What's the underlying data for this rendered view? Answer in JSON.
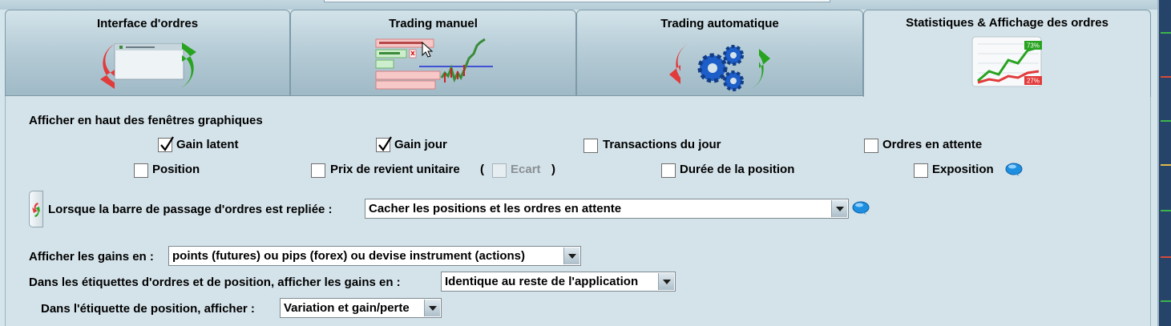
{
  "tabs": [
    {
      "label": "Interface d'ordres",
      "icon": "order-interface-icon"
    },
    {
      "label": "Trading manuel",
      "icon": "manual-trading-icon"
    },
    {
      "label": "Trading automatique",
      "icon": "automatic-trading-icon"
    },
    {
      "label": "Statistiques & Affichage des ordres",
      "icon": "statistics-chart-icon",
      "chart_badges": [
        "73%",
        "27%"
      ]
    }
  ],
  "section_title": "Afficher en haut des fenêtres graphiques",
  "checkboxes": {
    "gain_latent": {
      "label": "Gain latent",
      "checked": true
    },
    "gain_jour": {
      "label": "Gain jour",
      "checked": true
    },
    "transactions_du_jour": {
      "label": "Transactions du jour",
      "checked": false
    },
    "ordres_en_attente": {
      "label": "Ordres en attente",
      "checked": false
    },
    "position": {
      "label": "Position",
      "checked": false
    },
    "prix_de_revient": {
      "label": "Prix de revient unitaire",
      "checked": false
    },
    "ecart": {
      "label": "Ecart",
      "checked": false,
      "disabled": true
    },
    "duree_position": {
      "label": "Durée de la position",
      "checked": false
    },
    "exposition": {
      "label": "Exposition",
      "checked": false
    }
  },
  "paren_open": "(",
  "paren_close": ")",
  "collapsed_bar": {
    "label": "Lorsque la barre de passage d'ordres est repliée :",
    "value": "Cacher les positions et les ordres en attente"
  },
  "gains_unit": {
    "label": "Afficher les gains en :",
    "value": "points (futures) ou pips (forex) ou devise instrument (actions)"
  },
  "labels_gains": {
    "label": "Dans les étiquettes d'ordres et de position, afficher les gains en :",
    "value": "Identique au reste de l'application"
  },
  "position_label": {
    "label": "Dans l'étiquette de position, afficher :",
    "value": "Variation et gain/perte"
  },
  "colors": {
    "accent_green": "#27a31f",
    "accent_red": "#e23b3b",
    "gear_blue": "#1d5ec9",
    "info_blue": "#1e8fe0"
  }
}
